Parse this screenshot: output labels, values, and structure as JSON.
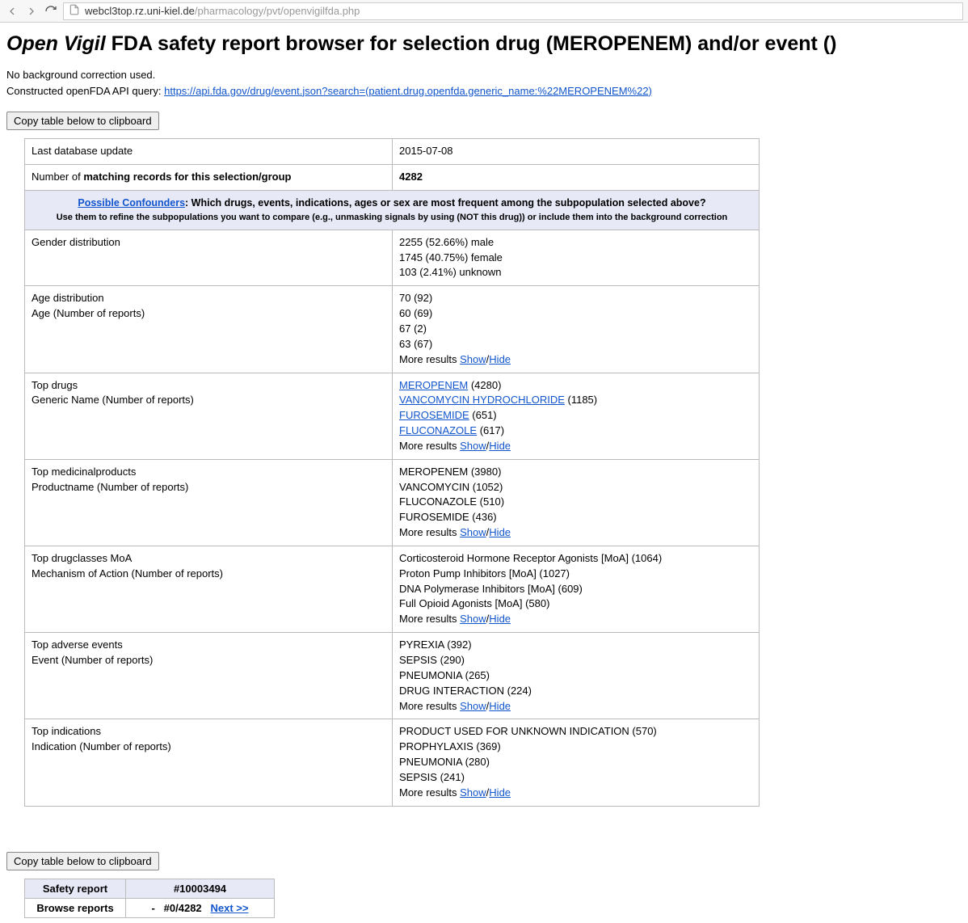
{
  "browser": {
    "url_host": "webcl3top.rz.uni-kiel.de",
    "url_path": "/pharmacology/pvt/openvigilfda.php"
  },
  "title": {
    "ov": "Open Vigil",
    "rest": " FDA safety report browser for selection drug (MEROPENEM) and/or event ()"
  },
  "intro": {
    "line1": "No background correction used.",
    "line2_pre": "Constructed openFDA API query: ",
    "line2_link": "https://api.fda.gov/drug/event.json?search=(patient.drug.openfda.generic_name:%22MEROPENEM%22)"
  },
  "copy_btn": "Copy table below to clipboard",
  "summary": {
    "last_update_label": "Last database update",
    "last_update_value": "2015-07-08",
    "matching_pre": "Number of ",
    "matching_bold": "matching records for this selection/group",
    "matching_value": "4282"
  },
  "confounders": {
    "pc": "Possible Confounders",
    "main": ": Which drugs, events, indications, ages or sex are most frequent among the subpopulation selected above?",
    "sub": "Use them to refine the subpopulations you want to compare (e.g., unmasking signals by using (NOT this drug)) or include them into the background correction"
  },
  "rows": {
    "gender": {
      "label": "Gender distribution",
      "lines": [
        "2255 (52.66%) male",
        "1745 (40.75%) female",
        "103 (2.41%) unknown"
      ]
    },
    "age": {
      "label1": "Age distribution",
      "label2": "Age (Number of reports)",
      "lines": [
        "70 (92)",
        "60 (69)",
        "67 (2)",
        "63 (67)"
      ]
    },
    "drugs": {
      "label1": "Top drugs",
      "label2": "Generic Name (Number of reports)",
      "links": [
        {
          "name": "MEROPENEM",
          "count": " (4280)"
        },
        {
          "name": "VANCOMYCIN HYDROCHLORIDE",
          "count": " (1185)"
        },
        {
          "name": "FUROSEMIDE",
          "count": " (651)"
        },
        {
          "name": "FLUCONAZOLE",
          "count": " (617)"
        }
      ]
    },
    "med": {
      "label1": "Top medicinalproducts",
      "label2": "Productname (Number of reports)",
      "lines": [
        "MEROPENEM (3980)",
        "VANCOMYCIN (1052)",
        "FLUCONAZOLE (510)",
        "FUROSEMIDE (436)"
      ]
    },
    "moa": {
      "label1": "Top drugclasses MoA",
      "label2": "Mechanism of Action (Number of reports)",
      "lines": [
        "Corticosteroid Hormone Receptor Agonists [MoA] (1064)",
        "Proton Pump Inhibitors [MoA] (1027)",
        "DNA Polymerase Inhibitors [MoA] (609)",
        "Full Opioid Agonists [MoA] (580)"
      ]
    },
    "ae": {
      "label1": "Top adverse events",
      "label2": "Event (Number of reports)",
      "lines": [
        "PYREXIA (392)",
        "SEPSIS (290)",
        "PNEUMONIA (265)",
        "DRUG INTERACTION (224)"
      ]
    },
    "ind": {
      "label1": "Top indications",
      "label2": "Indication (Number of reports)",
      "lines": [
        "PRODUCT USED FOR UNKNOWN INDICATION (570)",
        "PROPHYLAXIS (369)",
        "PNEUMONIA (280)",
        "SEPSIS (241)"
      ]
    }
  },
  "more": {
    "pre": "More results ",
    "show": "Show",
    "hide": "Hide"
  },
  "report": {
    "sr_label": "Safety report",
    "sr_value": "#10003494",
    "br_label": "Browse reports",
    "br_dash": "-",
    "br_pos": "#0/4282",
    "br_next": "Next >>"
  }
}
